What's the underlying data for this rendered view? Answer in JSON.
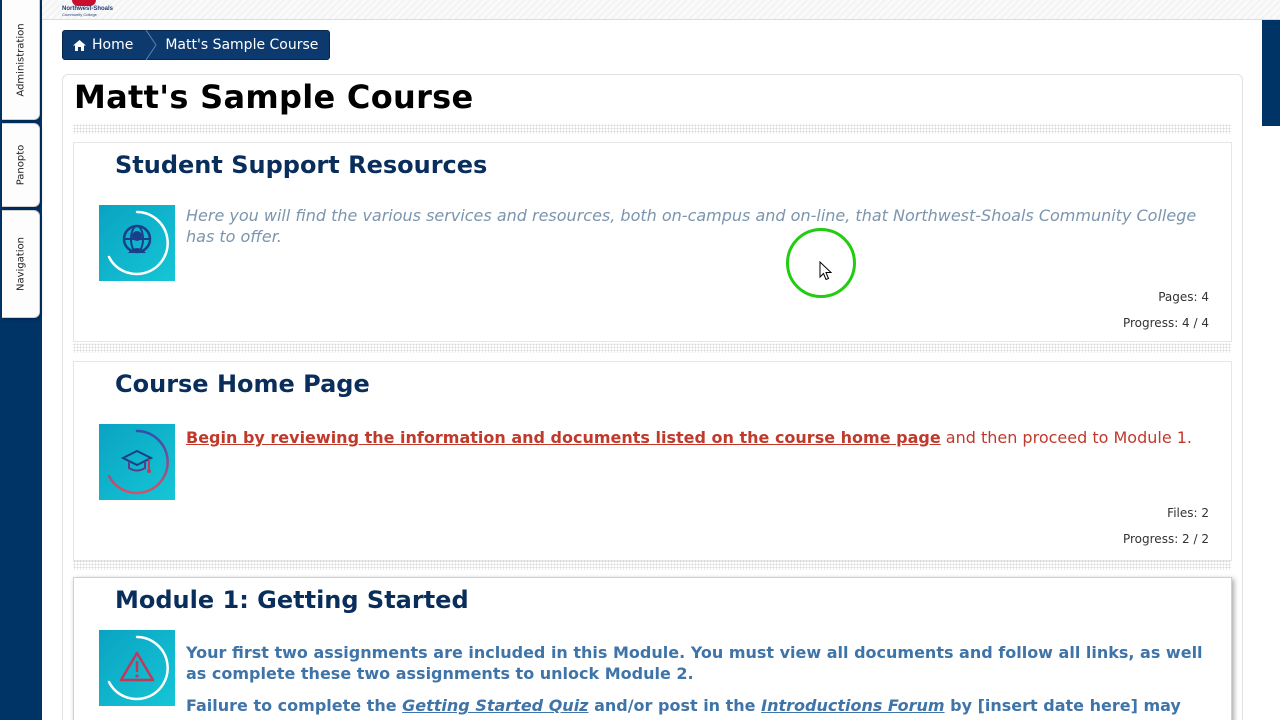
{
  "side_panel": {
    "tabs": [
      {
        "label": "Administration"
      },
      {
        "label": "Panopto"
      },
      {
        "label": "Navigation"
      }
    ]
  },
  "header": {
    "logo_line1": "Northwest-Shoals",
    "logo_line2": "Community College"
  },
  "breadcrumb": {
    "home": "Home",
    "course": "Matt's Sample Course"
  },
  "page": {
    "title": "Matt's Sample Course"
  },
  "sections": [
    {
      "title": "Student Support Resources",
      "icon": "globe-person-icon",
      "description": "Here you will find the various services and resources, both on-campus and on-line, that Northwest-Shoals Community College has to offer.",
      "meta_count": "Pages: 4",
      "meta_progress": "Progress: 4 / 4"
    },
    {
      "title": "Course Home Page",
      "icon": "graduation-cap-icon",
      "link_text": "Begin by reviewing the information and documents listed on the course home page",
      "trailing_text": " and then proceed to Module 1.",
      "meta_count": "Files: 2",
      "meta_progress": "Progress: 2 / 2"
    },
    {
      "title": "Module 1: Getting Started",
      "icon": "warning-triangle-icon",
      "paragraph1": "Your first two assignments are included in this Module. You must view all documents and follow all links, as well as complete these two assignments to unlock Module 2.",
      "p2_lead": "Failure to complete the ",
      "p2_link1": "Getting Started Quiz",
      "p2_mid": " and/or post in the ",
      "p2_link2": "Introductions Forum",
      "p2_tail": " by [insert date here] may"
    }
  ],
  "colors": {
    "navy": "#003366",
    "heading": "#0a2e5c",
    "link_red": "#c0392b",
    "muted_blue": "#7b95ae",
    "cursor_green": "#22cc11"
  }
}
